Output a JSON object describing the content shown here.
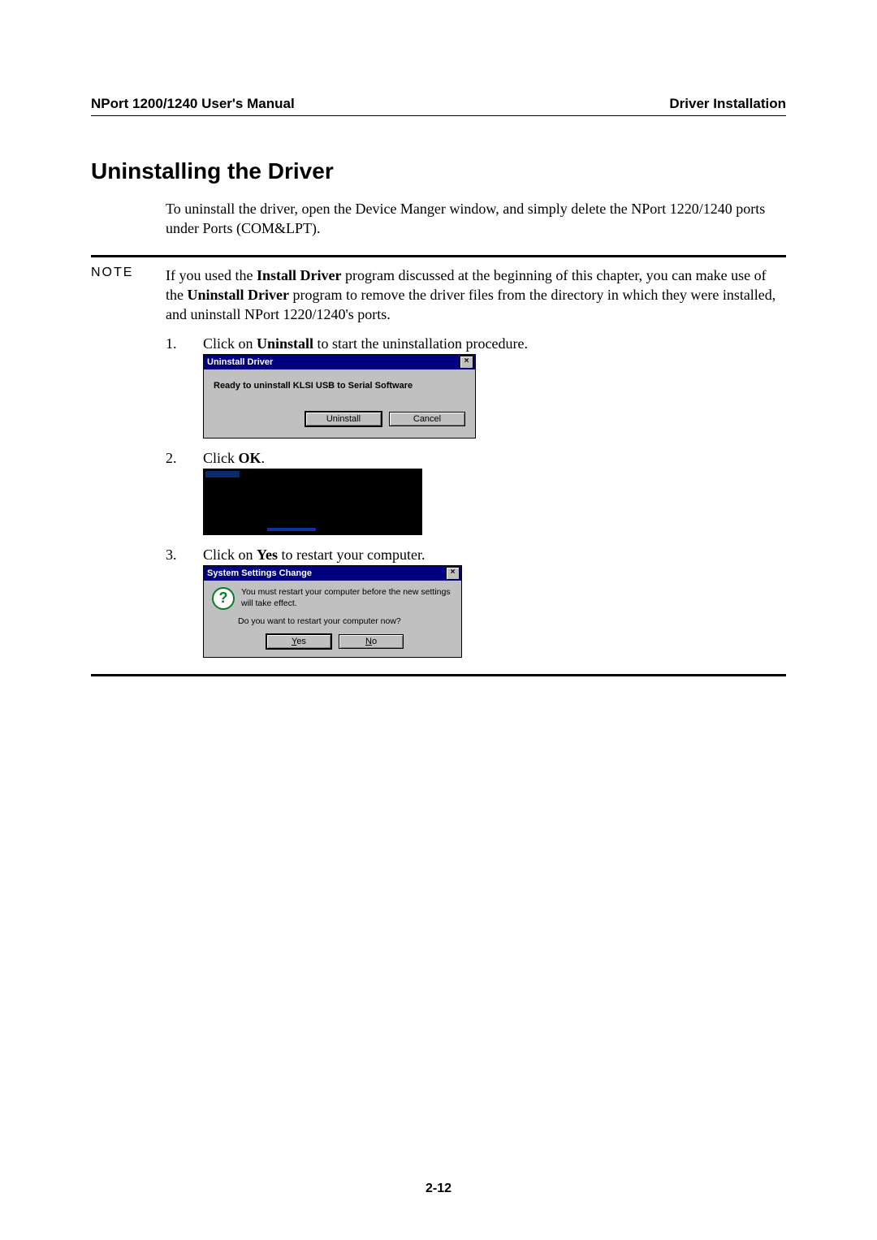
{
  "header": {
    "left": "NPort 1200/1240 User's Manual",
    "right": "Driver Installation"
  },
  "title": "Uninstalling the Driver",
  "intro": "To uninstall the driver, open the Device Manger window, and simply delete the NPort 1220/1240 ports under Ports (COM&LPT).",
  "note": {
    "label": "NOTE",
    "text_pre": "If you used the ",
    "bold1": "Install Driver",
    "text_mid1": " program discussed at the beginning of this chapter, you can make use of the ",
    "bold2": "Uninstall Driver",
    "text_mid2": " program to remove the driver files from the directory in which they were installed, and uninstall NPort 1220/1240's ports."
  },
  "steps": {
    "s1": {
      "num": "1.",
      "pre": "Click on ",
      "bold": "Uninstall",
      "post": " to start the uninstallation procedure."
    },
    "s2": {
      "num": "2.",
      "pre": "Click ",
      "bold": "OK",
      "post": "."
    },
    "s3": {
      "num": "3.",
      "pre": "Click on ",
      "bold": "Yes",
      "post": " to restart your computer."
    }
  },
  "dlg1": {
    "title": "Uninstall Driver",
    "close": "×",
    "message": "Ready to uninstall KLSI USB to Serial Software",
    "btn_uninstall": "Uninstall",
    "btn_cancel": "Cancel"
  },
  "dlg3": {
    "title": "System Settings Change",
    "close": "×",
    "q": "?",
    "msg1": "You must restart your computer before the new settings will take effect.",
    "msg2": "Do you want to restart your computer now?",
    "yes_u": "Y",
    "yes_rest": "es",
    "no_u": "N",
    "no_rest": "o"
  },
  "page_number": "2-12"
}
